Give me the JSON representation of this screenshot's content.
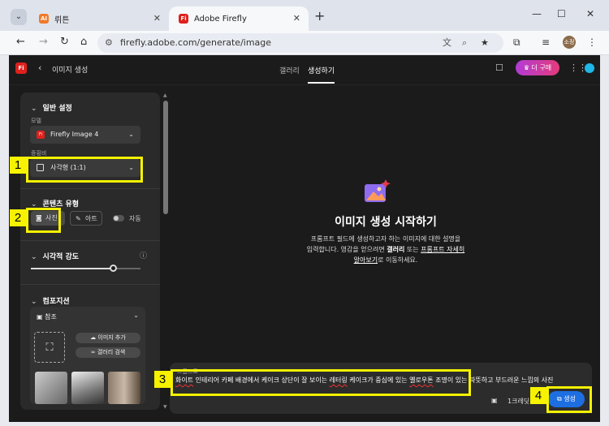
{
  "browser": {
    "tabs": [
      {
        "label": "뤼튼",
        "favicon": "AI"
      },
      {
        "label": "Adobe Firefly",
        "favicon": "Fi"
      }
    ],
    "url": "firefly.adobe.com/generate/image",
    "profile_initials": "소정"
  },
  "app": {
    "logo": "Fi",
    "page_title": "이미지 생성",
    "nav_tabs": [
      "갤러리",
      "생성하기"
    ],
    "buy_label": "더 구매"
  },
  "panel": {
    "general_settings": "일반 설정",
    "model_label": "모델",
    "model_value": "Firefly Image 4",
    "aspect_label": "종횡비",
    "aspect_value": "사각형 (1:1)",
    "content_type_title": "콘텐츠 유형",
    "content_photo": "사진",
    "content_art": "아트",
    "content_auto": "자동",
    "visual_intensity": "시각적 강도",
    "visual_intensity_level": 0.75,
    "composition_title": "컴포지션",
    "reference_label": "참조",
    "add_image": "이미지 추가",
    "gallery_search": "갤러리 검색"
  },
  "main": {
    "hero_title": "이미지 생성 시작하기",
    "desc_line1": "프롬프트 필드에 생성하고자 하는 이미지에 대한 설명을",
    "desc_line2a": "입력합니다. 영감을 얻으려면 ",
    "desc_gallery": "갤러리",
    "desc_line2b": " 또는 ",
    "desc_more": "프롬프트 자세히",
    "desc_more2": "알아보기",
    "desc_line3": "로 이동하세요.",
    "prompt_label": "프롬프트",
    "prompt_text": {
      "s1": "화이트",
      "s2": " 인테리어 카페 배경에서 케이크 상단이 잘 보이는 ",
      "s3": "레터링",
      "s4": " 케이크가 중심에 있는 ",
      "s5": "옐로우톤",
      "s6": " 조명이 있는 따뜻하고 부드러운 느낌의 사진"
    },
    "count_label": "1크레딧",
    "generate_label": "생성"
  },
  "annotations": [
    "1",
    "2",
    "3",
    "4"
  ],
  "colors": {
    "accent": "#1d6ee0",
    "highlight": "#f6f200",
    "brand": "#e0201c"
  }
}
